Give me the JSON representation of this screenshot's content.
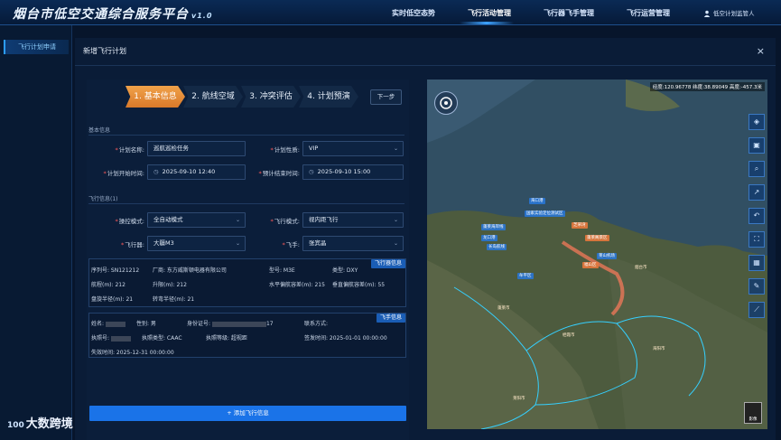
{
  "app": {
    "title": "烟台市低空交通综合服务平台",
    "version": "v1.0"
  },
  "nav": {
    "items": [
      {
        "label": "实时低空态势"
      },
      {
        "label": "飞行活动管理"
      },
      {
        "label": "飞行器飞手管理"
      },
      {
        "label": "飞行运营管理"
      }
    ],
    "active": "飞行活动管理",
    "user": "低空计划监管人"
  },
  "sidebar": {
    "items": [
      {
        "label": "飞行计划申请"
      }
    ]
  },
  "dialog": {
    "title": "新增飞行计划",
    "close": "×"
  },
  "steps": [
    {
      "label": "1. 基本信息",
      "active": true
    },
    {
      "label": "2. 航线空域"
    },
    {
      "label": "3. 冲突评估"
    },
    {
      "label": "4. 计划预演"
    }
  ],
  "next_button": "下一步",
  "basic": {
    "section": "基本信息",
    "plan_name_label": "计划名称:",
    "plan_name": "巡航巡检任务",
    "plan_type_label": "计划性质:",
    "plan_type": "VIP",
    "start_label": "计划开始时间:",
    "start": "2025-09-10 12:40",
    "end_label": "预计结束时间:",
    "end": "2025-09-10 15:00"
  },
  "flight": {
    "section": "飞行信息(1)",
    "control_label": "操控模式:",
    "control": "全自动模式",
    "mode_label": "飞行模式:",
    "mode": "视内距飞行",
    "aircraft_label": "飞行器:",
    "aircraft": "大疆M3",
    "pilot_label": "飞手:",
    "pilot": "张宾晶"
  },
  "aircraft_info": {
    "tag": "飞行器信息",
    "serial": "序列号:  SN121212",
    "maker": "厂商:  东方威斯顿电器有限公司",
    "model": "型号:  M3E",
    "type": "类型:  DXY",
    "range": "航程(m):  212",
    "ceiling": "升限(m):  212",
    "h_error": "水平偏航容差(m):  215",
    "v_error": "垂直偏航容差(m):  55",
    "hover": "盘旋半径(m):  21",
    "turn": "转弯半径(m):  21"
  },
  "pilot_info": {
    "tag": "飞手信息",
    "name": "姓名:",
    "gender": "性别:  男",
    "id_label": "身份证号:",
    "id_tail": "17",
    "contact": "联系方式:",
    "license_no": "执照号:",
    "license_type": "执照类型:  CAAC",
    "license_level": "执照等级:  超视距",
    "issue": "签发时间:  2025-01-01 00:00:00",
    "expire": "失效时间:  2025-12-31 00:00:00"
  },
  "add_flight_button": "+ 添加飞行信息",
  "map": {
    "coord": "经度:120.96778 纬度:38.89049 高度:-457.3米",
    "labels": [
      {
        "text": "海口港",
        "style": "blue"
      },
      {
        "text": "国家实验定位测试区",
        "style": "blue"
      },
      {
        "text": "芝罘湾",
        "style": "orange"
      },
      {
        "text": "蓬莱海岸线",
        "style": "blue"
      },
      {
        "text": "龙口港",
        "style": "blue"
      },
      {
        "text": "蓬莱阁景区",
        "style": "orange"
      },
      {
        "text": "长岛航线",
        "style": "blue"
      },
      {
        "text": "莱山机场",
        "style": "blue"
      },
      {
        "text": "福山区",
        "style": "orange"
      },
      {
        "text": "牟平区",
        "style": "blue"
      }
    ],
    "places": [
      "烟台市",
      "海阳市",
      "莱阳市",
      "栖霞市",
      "蓬莱市"
    ],
    "layer_label": "影像"
  },
  "tools": [
    "layers-icon",
    "image-icon",
    "search-icon",
    "chart-icon",
    "undo-icon",
    "expand-icon",
    "grid-icon",
    "edit-icon",
    "measure-icon"
  ],
  "logo": {
    "num": "100",
    "text": "大数跨境"
  }
}
